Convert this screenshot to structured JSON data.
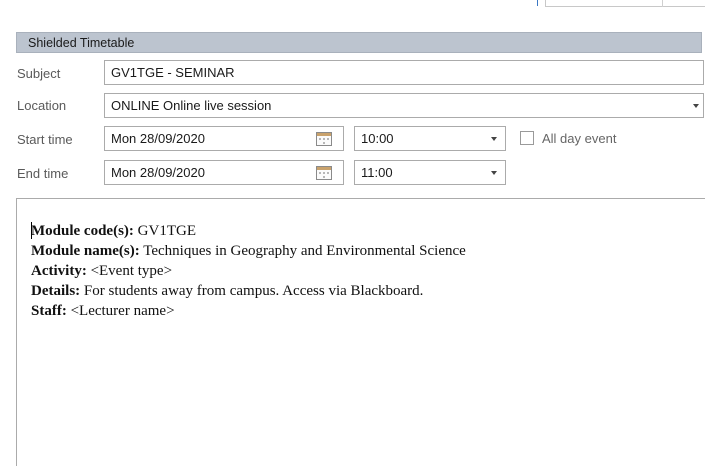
{
  "header": {
    "title": "Shielded Timetable"
  },
  "subject": {
    "label": "Subject",
    "value": "GV1TGE - SEMINAR"
  },
  "location": {
    "label": "Location",
    "value": "ONLINE Online live session"
  },
  "start": {
    "label": "Start time",
    "date": "Mon 28/09/2020",
    "time": "10:00"
  },
  "end": {
    "label": "End time",
    "date": "Mon 28/09/2020",
    "time": "11:00"
  },
  "all_day": {
    "label": "All day event",
    "checked": false
  },
  "body": {
    "lines": [
      {
        "key": "Module code(s):",
        "value": " GV1TGE"
      },
      {
        "key": "Module name(s):",
        "value": " Techniques in Geography and Environmental Science"
      },
      {
        "key": "Activity:",
        "value": " <Event type>"
      },
      {
        "key": "Details:",
        "value": " For students away from campus. Access via Blackboard."
      },
      {
        "key": "Staff:",
        "value": " <Lecturer name>"
      }
    ]
  },
  "icons": {
    "calendar": "calendar-icon",
    "dropdown": "chevron-down-icon"
  }
}
